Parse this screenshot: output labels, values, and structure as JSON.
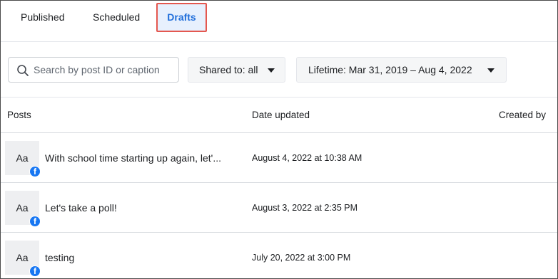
{
  "tabs": {
    "published": "Published",
    "scheduled": "Scheduled",
    "drafts": "Drafts",
    "active": "drafts"
  },
  "filters": {
    "search_placeholder": "Search by post ID or caption",
    "search_value": "",
    "shared_to": "Shared to: all",
    "lifetime": "Lifetime: Mar 31, 2019 – Aug 4, 2022"
  },
  "table": {
    "columns": {
      "posts": "Posts",
      "date_updated": "Date updated",
      "created_by": "Created by"
    },
    "rows": [
      {
        "thumb": "Aa",
        "badge": "f",
        "title": "With school time starting up again, let'...",
        "date": "August 4, 2022 at 10:38 AM",
        "created_by": ""
      },
      {
        "thumb": "Aa",
        "badge": "f",
        "title": "Let's take a poll!",
        "date": "August 3, 2022 at 2:35 PM",
        "created_by": ""
      },
      {
        "thumb": "Aa",
        "badge": "f",
        "title": "testing",
        "date": "July 20, 2022 at 3:00 PM",
        "created_by": ""
      }
    ]
  },
  "colors": {
    "active_tab_text": "#216fdb",
    "active_tab_bg": "#e7f0fd",
    "highlight_border": "#e4574f",
    "facebook_blue": "#1877f2"
  },
  "icons": {
    "search": "search-icon",
    "caret": "caret-down-icon",
    "platform": "facebook-icon"
  }
}
